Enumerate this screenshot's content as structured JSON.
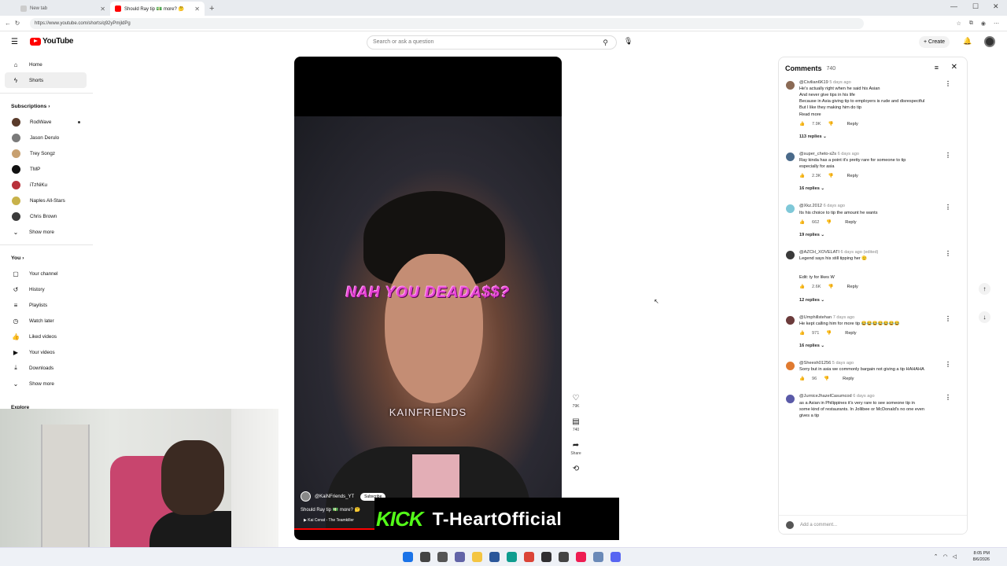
{
  "browser": {
    "tabs": [
      {
        "title": "New tab",
        "active": false
      },
      {
        "title": "Should Ray tip 💵 more? 🤔",
        "active": true
      }
    ],
    "new_tab": "+",
    "url": "https://www.youtube.com/shorts/q92yPmjldPg",
    "window_controls": [
      "—",
      "☐",
      "✕"
    ]
  },
  "header": {
    "logo": "YouTube",
    "search_placeholder": "Search or ask a question",
    "create_label": "+ Create"
  },
  "sidebar": {
    "main": [
      {
        "label": "Home",
        "icon": "home-icon",
        "glyph": "⌂"
      },
      {
        "label": "Shorts",
        "icon": "shorts-icon",
        "glyph": "ϟ",
        "active": true
      }
    ],
    "subs_header": "Subscriptions ›",
    "subscriptions": [
      {
        "label": "RodWave",
        "color": "#5a3b2b",
        "live": true
      },
      {
        "label": "Jason Derulo",
        "color": "#7a7a7a"
      },
      {
        "label": "Trey Songz",
        "color": "#c7a070"
      },
      {
        "label": "TMP",
        "color": "#111111"
      },
      {
        "label": "iTzNiKu",
        "color": "#b8313a"
      },
      {
        "label": "Naples All-Stars",
        "color": "#c8b24a"
      },
      {
        "label": "Chris Brown",
        "color": "#3b3b3b"
      }
    ],
    "show_more_1": "Show more",
    "you_header": "You ›",
    "you_items": [
      {
        "label": "Your channel",
        "glyph": "▢"
      },
      {
        "label": "History",
        "glyph": "↺"
      },
      {
        "label": "Playlists",
        "glyph": "≡"
      },
      {
        "label": "Watch later",
        "glyph": "◷"
      },
      {
        "label": "Liked videos",
        "glyph": "👍"
      },
      {
        "label": "Your videos",
        "glyph": "▶"
      },
      {
        "label": "Downloads",
        "glyph": "⤓"
      }
    ],
    "show_more_2": "Show more",
    "explore": "Explore"
  },
  "video": {
    "caption": "NAH YOU DEADA$$?",
    "watermark": "KAINFRIENDS",
    "channel": "@KaiNFriends_YT",
    "subscribe": "Subscribe",
    "title": "Should Ray tip 💵 more? 🤔",
    "song": "▶ Kai Cenat - The Teamkiller",
    "progress": 0.3
  },
  "actions": [
    {
      "icon": "like-icon",
      "glyph": "♡",
      "label": "79K"
    },
    {
      "icon": "comment-icon",
      "glyph": "▤",
      "label": "740"
    },
    {
      "icon": "share-icon",
      "glyph": "➦",
      "label": "Share"
    },
    {
      "icon": "remix-icon",
      "glyph": "⟲",
      "label": ""
    }
  ],
  "overlay": {
    "kick": "KICK",
    "name": "T-HeartOfficial"
  },
  "comments": {
    "title": "Comments",
    "count": "740",
    "add_placeholder": "Add a comment...",
    "items": [
      {
        "author": "@Civilian6K19",
        "time": "5 days ago",
        "color": "#8b6a55",
        "text": [
          "He's actually right when he said his Asian",
          "And never give tips in his life",
          "Because in Asia giving tip to employers is rude and disrespectful",
          "But I like they making him do tip"
        ],
        "read_more": "Read more",
        "likes": "7.9K",
        "reply": "Reply",
        "replies": "113 replies"
      },
      {
        "author": "@super_cheto-s2s",
        "time": "6 days ago",
        "color": "#4a6a8a",
        "text": [
          "Ray kinda has a point it's pretty rare for someone to tip",
          "especially for asia"
        ],
        "likes": "2.3K",
        "reply": "Reply",
        "replies": "16 replies"
      },
      {
        "author": "@Xkz.2012",
        "time": "6 days ago",
        "color": "#7fc8d8",
        "text": [
          "Its his choice to tip the amount he wants"
        ],
        "likes": "662",
        "reply": "Reply",
        "replies": "19 replies"
      },
      {
        "author": "@AZCH_XOVELATI",
        "time": "6 days ago (edited)",
        "color": "#3a3a3a",
        "text": [
          "Legend says his still tipping her 🫡",
          "",
          "",
          "Edit: ty for likes W"
        ],
        "likes": "2.6K",
        "reply": "Reply",
        "replies": "12 replies"
      },
      {
        "author": "@Umphillstehan",
        "time": "7 days ago",
        "color": "#6b3b3b",
        "text": [
          "He kept calling him for more tip 😂😂😂😂😂😂😂"
        ],
        "likes": "971",
        "reply": "Reply",
        "replies": "16 replies"
      },
      {
        "author": "@Sheesh01256",
        "time": "5 days ago",
        "color": "#e07a30",
        "text": [
          "Sorry but in asia we commonly bargain not giving a tip HAHAHA"
        ],
        "likes": "96",
        "reply": "Reply"
      },
      {
        "author": "@JurniceJhazelCasumcod",
        "time": "6 days ago",
        "color": "#5a5aa8",
        "text": [
          "as a Asian in Philippines it's very rare to see someone tip in",
          "some kind of restaurants. In Jollibee or McDonald's no one even",
          "gives a tip"
        ]
      }
    ]
  },
  "taskbar": {
    "apps": [
      {
        "name": "windows-start-icon",
        "color": "#1a73e8"
      },
      {
        "name": "search-icon",
        "color": "#444444"
      },
      {
        "name": "taskview-icon",
        "color": "#555555"
      },
      {
        "name": "chat-icon",
        "color": "#6264a7"
      },
      {
        "name": "explorer-icon",
        "color": "#f4c542"
      },
      {
        "name": "store-icon",
        "color": "#2b579a"
      },
      {
        "name": "edge-icon",
        "color": "#0f9d8f"
      },
      {
        "name": "chrome-icon",
        "color": "#db4437"
      },
      {
        "name": "obs-icon",
        "color": "#302e31"
      },
      {
        "name": "app-icon",
        "color": "#444444"
      },
      {
        "name": "tiktok-icon",
        "color": "#ee1d52"
      },
      {
        "name": "monitor-icon",
        "color": "#6b8ab8"
      },
      {
        "name": "discord-icon",
        "color": "#5865f2"
      }
    ],
    "time": "8:05 PM",
    "date": "8/6/2026"
  }
}
